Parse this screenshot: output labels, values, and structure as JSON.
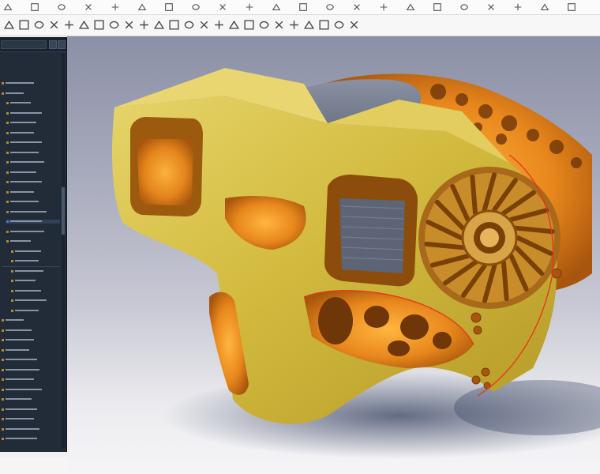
{
  "app": {
    "kind": "cad-generative-design-viewer",
    "accent_color": "#e6b024",
    "panel_color": "#222c38",
    "highlight_color": "#2f7fd6"
  },
  "toolbar_top": {
    "icons": [
      "cursor-icon",
      "pencil-icon",
      "line-icon",
      "arc-icon",
      "curve-icon",
      "spline-icon",
      "fillet-icon",
      "trim-icon",
      "extend-icon",
      "offset-icon",
      "mirror-icon",
      "pattern-icon",
      "dimension-icon",
      "constraint-icon",
      "measure-icon",
      "section-icon",
      "render-icon",
      "light-icon",
      "material-icon",
      "camera-icon",
      "settings-icon",
      "help-icon"
    ]
  },
  "toolbar_main": {
    "icons": [
      "new-sketch-icon",
      "extrude-icon",
      "revolve-icon",
      "sweep-icon",
      "loft-icon",
      "shell-icon",
      "hole-icon",
      "thread-icon",
      "split-icon",
      "combine-icon",
      "move-icon",
      "align-icon",
      "press-pull-icon",
      "generative-design-icon",
      "mesh-icon",
      "simulate-icon",
      "stress-icon",
      "thermal-icon",
      "optimize-icon",
      "lattice-icon",
      "export-icon",
      "view-cube-icon",
      "grid-icon",
      "display-settings-icon"
    ]
  },
  "side_panel": {
    "title": "",
    "search_placeholder": "",
    "tree_items": [
      {
        "indent": 0,
        "width": 0.55
      },
      {
        "indent": 0,
        "width": 0.35
      },
      {
        "indent": 1,
        "width": 0.4
      },
      {
        "indent": 1,
        "width": 0.6
      },
      {
        "indent": 1,
        "width": 0.5
      },
      {
        "indent": 1,
        "width": 0.45
      },
      {
        "indent": 1,
        "width": 0.6
      },
      {
        "indent": 1,
        "width": 0.55
      },
      {
        "indent": 1,
        "width": 0.65
      },
      {
        "indent": 1,
        "width": 0.5
      },
      {
        "indent": 1,
        "width": 0.6
      },
      {
        "indent": 1,
        "width": 0.45
      },
      {
        "indent": 1,
        "width": 0.55
      },
      {
        "indent": 1,
        "width": 0.7
      },
      {
        "indent": 1,
        "width": 0.6,
        "active": true
      },
      {
        "indent": 1,
        "width": 0.65
      },
      {
        "indent": 1,
        "width": 0.4
      },
      {
        "indent": 2,
        "width": 0.5
      },
      {
        "indent": 2,
        "width": 0.45
      },
      {
        "indent": 2,
        "width": 0.55
      },
      {
        "indent": 2,
        "width": 0.4
      },
      {
        "indent": 2,
        "width": 0.5
      },
      {
        "indent": 2,
        "width": 0.6
      },
      {
        "indent": 2,
        "width": 0.45
      },
      {
        "indent": 0,
        "width": 0.35
      },
      {
        "indent": 0,
        "width": 0.5
      },
      {
        "indent": 0,
        "width": 0.55
      },
      {
        "indent": 0,
        "width": 0.45
      },
      {
        "indent": 0,
        "width": 0.6
      },
      {
        "indent": 0,
        "width": 0.65
      },
      {
        "indent": 0,
        "width": 0.55
      },
      {
        "indent": 0,
        "width": 0.7
      },
      {
        "indent": 0,
        "width": 0.5
      },
      {
        "indent": 0,
        "width": 0.6
      },
      {
        "indent": 0,
        "width": 0.55
      },
      {
        "indent": 0,
        "width": 0.65
      },
      {
        "indent": 0,
        "width": 0.6
      }
    ]
  },
  "viewport": {
    "model": "generative-design-bracket",
    "body_color": "#d8c24a",
    "copper_color": "#e88d1c",
    "core_color": "#6e7586",
    "shadow_color": "#3d4966"
  }
}
